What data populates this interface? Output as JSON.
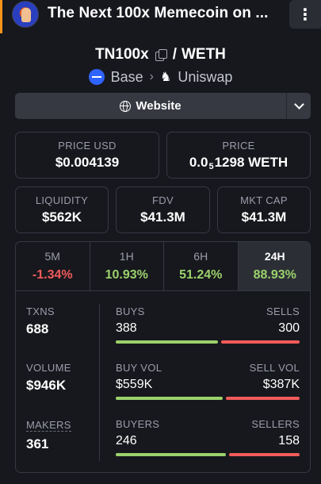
{
  "header": {
    "title": "The Next 100x Memecoin on ...",
    "menu_icon": "⋮"
  },
  "pair": {
    "base_symbol": "TN100x",
    "separator": "/",
    "quote_symbol": "WETH"
  },
  "chain": {
    "network": "Base",
    "dex": "Uniswap"
  },
  "website": {
    "label": "Website"
  },
  "price": {
    "usd_label": "PRICE USD",
    "usd_value": "$0.004139",
    "native_label": "PRICE",
    "native_prefix": "0.0",
    "native_zeros": "5",
    "native_digits": "1298",
    "native_unit": "WETH"
  },
  "metrics_top": [
    {
      "label": "LIQUIDITY",
      "value": "$562K"
    },
    {
      "label": "FDV",
      "value": "$41.3M"
    },
    {
      "label": "MKT CAP",
      "value": "$41.3M"
    }
  ],
  "timeframes": [
    {
      "label": "5M",
      "change": "-1.34%",
      "direction": "neg",
      "active": false
    },
    {
      "label": "1H",
      "change": "10.93%",
      "direction": "pos",
      "active": false
    },
    {
      "label": "6H",
      "change": "51.24%",
      "direction": "pos",
      "active": false
    },
    {
      "label": "24H",
      "change": "88.93%",
      "direction": "pos",
      "active": true
    }
  ],
  "activity": {
    "txns": {
      "label": "TXNS",
      "value": "688"
    },
    "volume": {
      "label": "VOLUME",
      "value": "$946K"
    },
    "makers": {
      "label": "MAKERS",
      "value": "361"
    }
  },
  "splits": {
    "txns": {
      "left_label": "BUYS",
      "left_value": "388",
      "right_label": "SELLS",
      "right_value": "300",
      "buy_share": 0.564
    },
    "volume": {
      "left_label": "BUY VOL",
      "left_value": "$559K",
      "right_label": "SELL VOL",
      "right_value": "$387K",
      "buy_share": 0.59
    },
    "makers": {
      "left_label": "BUYERS",
      "left_value": "246",
      "right_label": "SELLERS",
      "right_value": "158",
      "buy_share": 0.609
    }
  },
  "colors": {
    "positive": "#9bd26c",
    "negative": "#f15b5b",
    "background": "#17181d",
    "accent": "#f7931a"
  }
}
